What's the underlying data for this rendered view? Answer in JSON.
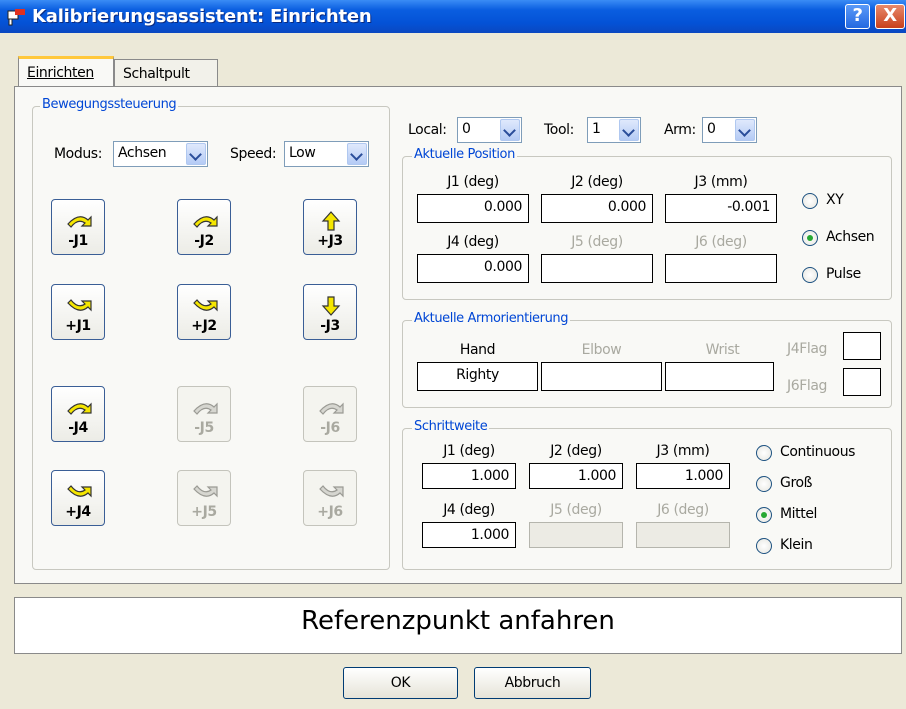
{
  "window": {
    "title": "Kalibrierungsassistent: Einrichten",
    "help_label": "?",
    "close_label": "X"
  },
  "tabs": [
    "Einrichten",
    "Schaltpult"
  ],
  "motion": {
    "group_label": "Bewegungssteuerung",
    "mode_label": "Modus:",
    "mode_value": "Achsen",
    "speed_label": "Speed:",
    "speed_value": "Low",
    "buttons": [
      {
        "label": "-J1",
        "icon": "rotate-ccw-arrow-icon",
        "enabled": true
      },
      {
        "label": "-J2",
        "icon": "rotate-ccw-arrow-icon",
        "enabled": true
      },
      {
        "label": "+J3",
        "icon": "arrow-up-icon",
        "enabled": true
      },
      {
        "label": "+J1",
        "icon": "rotate-cw-arrow-icon",
        "enabled": true
      },
      {
        "label": "+J2",
        "icon": "rotate-cw-arrow-icon",
        "enabled": true
      },
      {
        "label": "-J3",
        "icon": "arrow-down-icon",
        "enabled": true
      },
      {
        "label": "-J4",
        "icon": "rotate-ccw-arrow-icon",
        "enabled": true
      },
      {
        "label": "-J5",
        "icon": "rotate-ccw-arrow-icon",
        "enabled": false
      },
      {
        "label": "-J6",
        "icon": "rotate-ccw-arrow-icon",
        "enabled": false
      },
      {
        "label": "+J4",
        "icon": "rotate-cw-arrow-icon",
        "enabled": true
      },
      {
        "label": "+J5",
        "icon": "rotate-cw-arrow-icon",
        "enabled": false
      },
      {
        "label": "+J6",
        "icon": "rotate-cw-arrow-icon",
        "enabled": false
      }
    ]
  },
  "selectors": {
    "local_label": "Local:",
    "local_value": "0",
    "tool_label": "Tool:",
    "tool_value": "1",
    "arm_label": "Arm:",
    "arm_value": "0"
  },
  "position": {
    "group_label": "Aktuelle Position",
    "headers": [
      "J1 (deg)",
      "J2 (deg)",
      "J3 (mm)",
      "J4 (deg)",
      "J5 (deg)",
      "J6 (deg)"
    ],
    "values": [
      "0.000",
      "0.000",
      "-0.001",
      "0.000",
      "",
      ""
    ],
    "modes": [
      {
        "label": "XY",
        "checked": false
      },
      {
        "label": "Achsen",
        "checked": true
      },
      {
        "label": "Pulse",
        "checked": false
      }
    ]
  },
  "orientation": {
    "group_label": "Aktuelle Armorientierung",
    "hand_label": "Hand",
    "hand_value": "Righty",
    "elbow_label": "Elbow",
    "elbow_value": "",
    "wrist_label": "Wrist",
    "wrist_value": "",
    "j4flag_label": "J4Flag",
    "j4flag_value": "",
    "j6flag_label": "J6Flag",
    "j6flag_value": ""
  },
  "step": {
    "group_label": "Schrittweite",
    "headers": [
      "J1 (deg)",
      "J2 (deg)",
      "J3 (mm)",
      "J4 (deg)",
      "J5 (deg)",
      "J6 (deg)"
    ],
    "values": [
      "1.000",
      "1.000",
      "1.000",
      "1.000",
      "",
      ""
    ],
    "options": [
      {
        "label": "Continuous",
        "checked": false
      },
      {
        "label": "Groß",
        "checked": false
      },
      {
        "label": "Mittel",
        "checked": true
      },
      {
        "label": "Klein",
        "checked": false
      }
    ]
  },
  "status_text": "Referenzpunkt anfahren",
  "footer": {
    "ok_label": "OK",
    "cancel_label": "Abbruch"
  },
  "colors": {
    "group_label": "#0046d5",
    "icon_fill": "#f5e600",
    "titlebar": "#0452d6",
    "radio_dot": "#27a833"
  }
}
